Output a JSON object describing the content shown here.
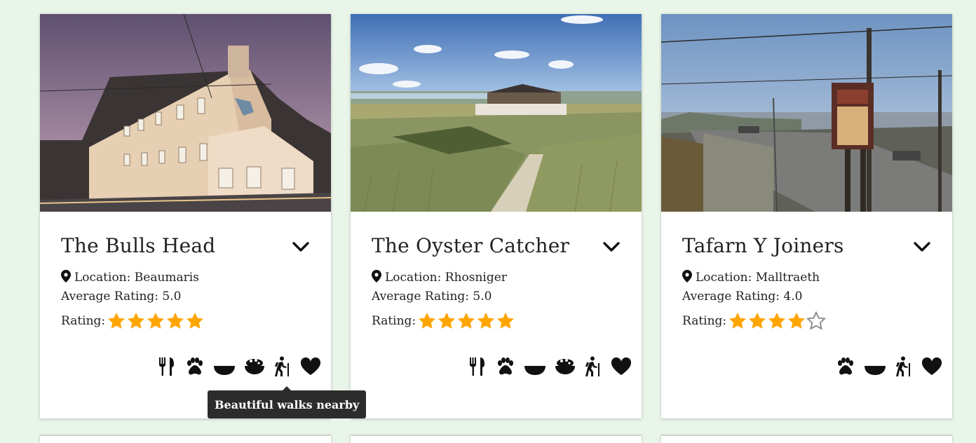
{
  "cards": [
    {
      "name": "The Bulls Head",
      "location": "Location: Beaumaris",
      "average_rating": "Average Rating: 5.0",
      "rating_label": "Rating:",
      "rating": 5,
      "image": "hotel-building-photo",
      "amenities": [
        "food-icon",
        "dog-friendly-icon",
        "bowl-icon",
        "meal-bowl-icon",
        "hiking-icon",
        "heart-icon"
      ]
    },
    {
      "name": "The Oyster Catcher",
      "location": "Location: Rhosniger",
      "average_rating": "Average Rating: 5.0",
      "rating_label": "Rating:",
      "rating": 5,
      "image": "beach-dunes-photo",
      "amenities": [
        "food-icon",
        "dog-friendly-icon",
        "bowl-icon",
        "meal-bowl-icon",
        "hiking-icon",
        "heart-icon"
      ]
    },
    {
      "name": "Tafarn Y Joiners",
      "location": "Location: Malltraeth",
      "average_rating": "Average Rating: 4.0",
      "rating_label": "Rating:",
      "rating": 4,
      "image": "pub-sign-photo",
      "amenities": [
        "dog-friendly-icon",
        "bowl-icon",
        "hiking-icon",
        "heart-icon"
      ]
    }
  ],
  "tooltip": "Beautiful walks nearby",
  "colors": {
    "background": "#e8f5e8",
    "star": "#ffa500",
    "text": "#222222",
    "tooltip_bg": "#2c2c2c"
  }
}
